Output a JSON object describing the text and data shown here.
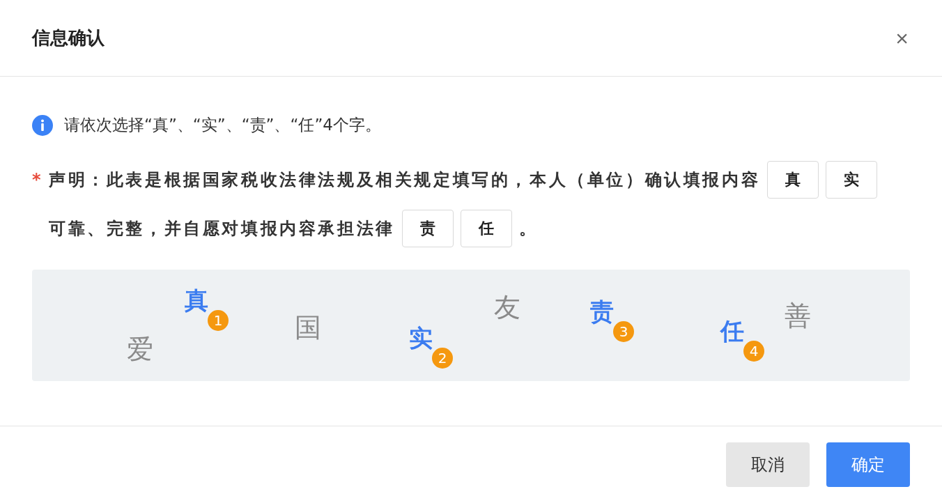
{
  "dialog": {
    "title": "信息确认",
    "close": "×"
  },
  "hint": "请依次选择“真”、“实”、“责”、“任”4个字。",
  "statement": {
    "required_mark": "*",
    "lines": [
      [
        {
          "kind": "text",
          "text": "声明：此表是根据国家税收法律法规及相关规定填写的，本人（单位）确认填报内容"
        },
        {
          "kind": "slot",
          "text": "真"
        },
        {
          "kind": "slot",
          "text": "实"
        }
      ],
      [
        {
          "kind": "text",
          "text": "可靠、完整，并自愿对填报内容承担法律"
        },
        {
          "kind": "slot",
          "text": "责"
        },
        {
          "kind": "slot",
          "text": "任"
        },
        {
          "kind": "text",
          "text": "。"
        }
      ]
    ]
  },
  "captcha": {
    "chars": [
      {
        "text": "真",
        "selected": true,
        "order": "1"
      },
      {
        "text": "爱",
        "selected": false
      },
      {
        "text": "国",
        "selected": false
      },
      {
        "text": "实",
        "selected": true,
        "order": "2"
      },
      {
        "text": "友",
        "selected": false
      },
      {
        "text": "责",
        "selected": true,
        "order": "3"
      },
      {
        "text": "任",
        "selected": true,
        "order": "4"
      },
      {
        "text": "善",
        "selected": false
      }
    ]
  },
  "buttons": [
    {
      "label": "取消",
      "kind": "secondary"
    },
    {
      "label": "确定",
      "kind": "primary"
    }
  ]
}
